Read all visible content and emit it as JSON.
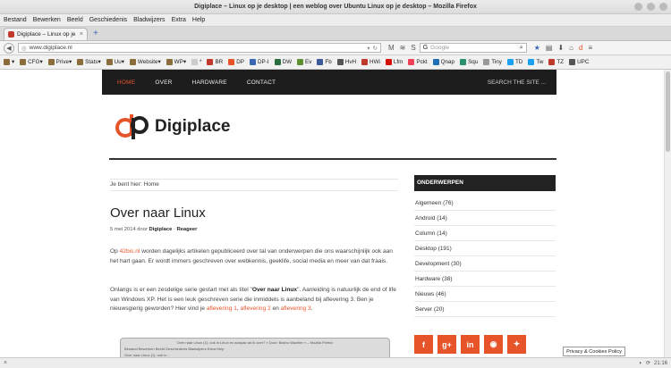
{
  "window": {
    "title": "Digiplace – Linux op je desktop | een weblog over Ubuntu Linux op je desktop – Mozilla Firefox"
  },
  "menu": [
    "Bestand",
    "Bewerken",
    "Beeld",
    "Geschiedenis",
    "Bladwijzers",
    "Extra",
    "Help"
  ],
  "tab": {
    "label": "Digiplace – Linux op je d...",
    "close": "×",
    "new": "+"
  },
  "nav": {
    "url": "www.digiplace.nl",
    "search_placeholder": "Google"
  },
  "bookmarks": [
    {
      "label": "▾",
      "color": "#8a6d3b"
    },
    {
      "label": "CFG▾",
      "color": "#8a6d3b"
    },
    {
      "label": "Prive▾",
      "color": "#8a6d3b"
    },
    {
      "label": "Stats▾",
      "color": "#8a6d3b"
    },
    {
      "label": "Uu▾",
      "color": "#8a6d3b"
    },
    {
      "label": "Website▾",
      "color": "#8a6d3b"
    },
    {
      "label": "WP▾",
      "color": "#8a6d3b"
    },
    {
      "label": "*",
      "color": "#cccccc"
    },
    {
      "label": "BR",
      "color": "#c0392b"
    },
    {
      "label": "DP",
      "color": "#e8542a"
    },
    {
      "label": "DP-I",
      "color": "#3a68b5"
    },
    {
      "label": "DW",
      "color": "#2c6e3f"
    },
    {
      "label": "Ev",
      "color": "#5e8f2f"
    },
    {
      "label": "Fb",
      "color": "#3b5998"
    },
    {
      "label": "HvH",
      "color": "#555555"
    },
    {
      "label": "HWi",
      "color": "#c0392b"
    },
    {
      "label": "Lfm",
      "color": "#d51007"
    },
    {
      "label": "Pckt",
      "color": "#ee4056"
    },
    {
      "label": "Qnap",
      "color": "#1f6fb2"
    },
    {
      "label": "Squ",
      "color": "#2a8f6a"
    },
    {
      "label": "Tiny",
      "color": "#999999"
    },
    {
      "label": "TD",
      "color": "#1da1f2"
    },
    {
      "label": "Tw",
      "color": "#1da1f2"
    },
    {
      "label": "TZ",
      "color": "#c0392b"
    },
    {
      "label": "UPC",
      "color": "#555555"
    }
  ],
  "site": {
    "nav": [
      "HOME",
      "OVER",
      "HARDWARE",
      "CONTACT"
    ],
    "search": "SEARCH THE SITE ...",
    "logo_text": "Digiplace",
    "breadcrumb": "Je bent hier: Home",
    "post_title": "Over naar Linux",
    "post_date": "5 mei 2014 door",
    "post_author": "Digiplace",
    "post_reply": "Reageer",
    "p1_pre": "Op ",
    "p1_link": "42bis.nl",
    "p1_post": " worden dagelijks artikelen gepubliceerd over tal van onderwerpen die ons waarschijnlijk ook aan het hart gaan. Er wordt immers geschreven over webkennis, geeklife, social media en meer van dat fraais.",
    "p2_pre": "Onlangs is er een zesdelige serie gestart met als titel \"",
    "p2_strong": "Over naar Linux",
    "p2_post": "\". Aanleiding is natuurlijk de end of life van Windows XP.  Het is een leuk geschreven serie die inmiddels is aanbeland bij aflevering 3. Ben je nieuwsgierig geworden? Hier vind je ",
    "p2_l1": "aflevering 1",
    "p2_sep1": ", ",
    "p2_l2": "aflevering 2",
    "p2_sep2": " en ",
    "p2_l3": "aflevering 3",
    "p2_end": ".",
    "thumb_title": "Over naar Linux (1): ook in Linux en aanpas wil ik over? » Door: Basho Wachter » – Mozilla Firefox",
    "thumb_menu": "Bestand  Bewerken  Beeld  Geschiedenis  Bladwijzers  Extra  Help",
    "thumb_tab": "Over naar Linux (1): ook in...",
    "sidebar_title": "ONDERWERPEN",
    "categories": [
      "Algemeen (76)",
      "Android (14)",
      "Column (14)",
      "Desktop (191)",
      "Development (30)",
      "Hardware (38)",
      "Nieuws (46)",
      "Server (20)"
    ],
    "social": [
      "f",
      "g+",
      "in",
      "rss",
      "t"
    ],
    "cookie": "Privacy & Cookies Policy"
  },
  "status": {
    "close": "×",
    "time": "21:16"
  }
}
